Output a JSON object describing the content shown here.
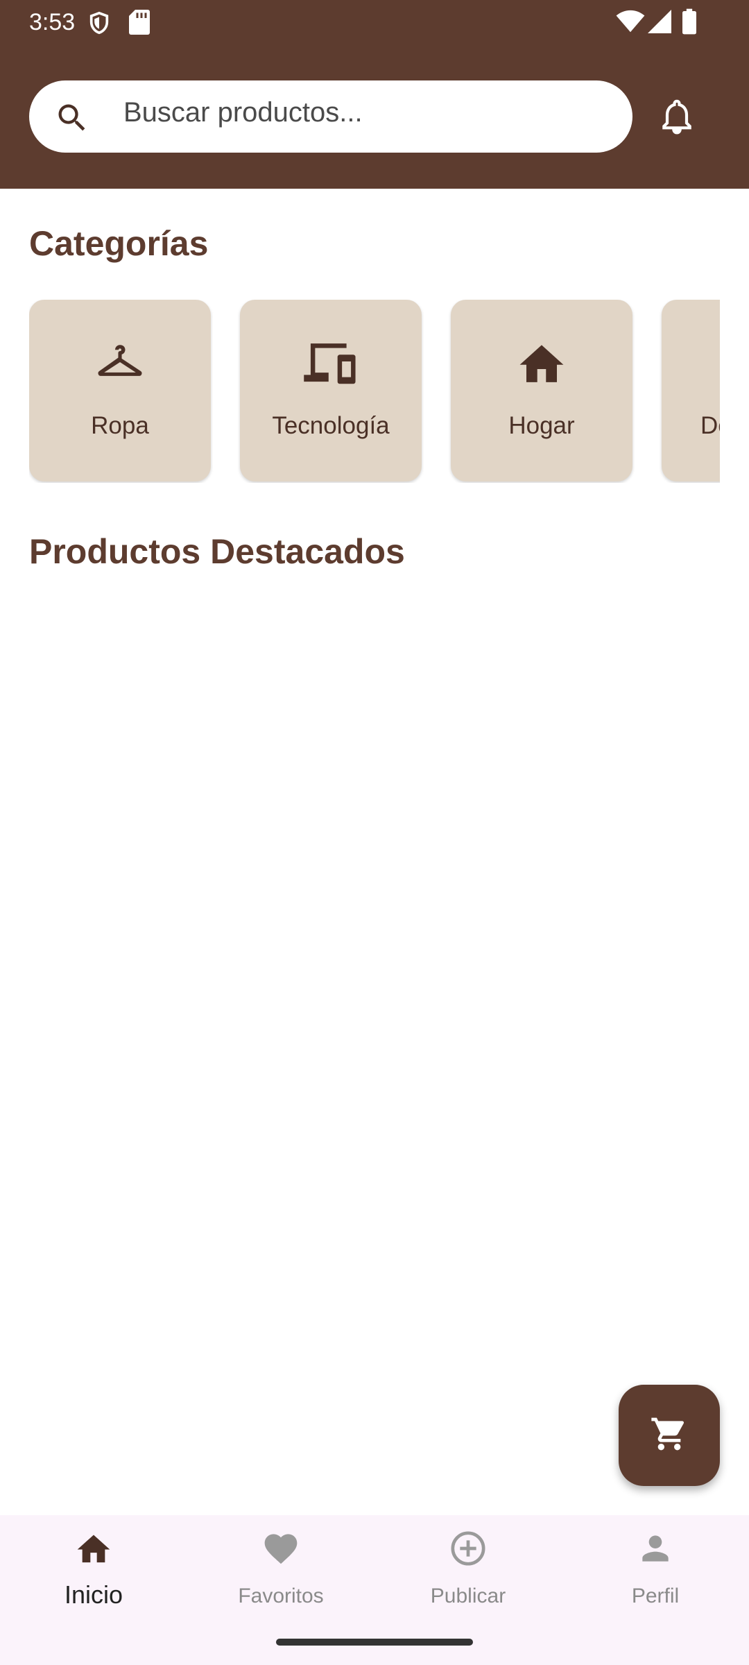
{
  "status_bar": {
    "time": "3:53"
  },
  "search": {
    "placeholder": "Buscar productos..."
  },
  "categories": {
    "title": "Categorías",
    "items": [
      {
        "label": "Ropa",
        "icon": "hanger-icon"
      },
      {
        "label": "Tecnología",
        "icon": "devices-icon"
      },
      {
        "label": "Hogar",
        "icon": "home-icon"
      },
      {
        "label": "De",
        "icon": ""
      }
    ]
  },
  "featured": {
    "title": "Productos Destacados"
  },
  "fab": {
    "icon": "cart-icon"
  },
  "bottom_nav": {
    "items": [
      {
        "label": "Inicio",
        "icon": "home-icon",
        "active": true
      },
      {
        "label": "Favoritos",
        "icon": "heart-icon",
        "active": false
      },
      {
        "label": "Publicar",
        "icon": "add-circle-icon",
        "active": false
      },
      {
        "label": "Perfil",
        "icon": "person-icon",
        "active": false
      }
    ]
  },
  "colors": {
    "primary": "#5d3c2f",
    "card": "#e1d5c6",
    "nav_bg": "#fbf3fb",
    "inactive": "#8a8a8a"
  }
}
